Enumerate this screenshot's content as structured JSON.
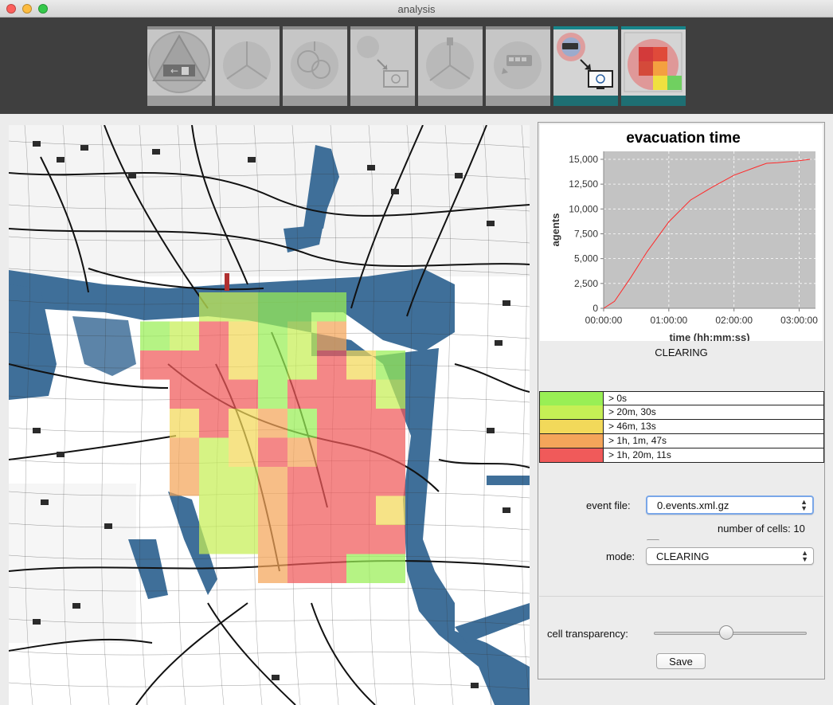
{
  "window": {
    "title": "analysis"
  },
  "toolbar": {
    "tools": [
      {
        "icon": "evacuation-area-icon",
        "state": "disabled"
      },
      {
        "icon": "population-icon",
        "state": "disabled"
      },
      {
        "icon": "population-circles-icon",
        "state": "disabled"
      },
      {
        "icon": "computation-icon",
        "state": "disabled"
      },
      {
        "icon": "road-closure-icon",
        "state": "disabled"
      },
      {
        "icon": "bus-stops-icon",
        "state": "disabled"
      },
      {
        "icon": "simulation-icon",
        "state": "active"
      },
      {
        "icon": "analysis-grid-icon",
        "state": "active"
      }
    ],
    "accent_color": "#17858a"
  },
  "chart": {
    "title": "evacuation time",
    "xlabel": "time (hh:mm:ss)",
    "ylabel": "agents"
  },
  "chart_data": {
    "type": "line",
    "title": "evacuation time",
    "xlabel": "time (hh:mm:ss)",
    "ylabel": "agents",
    "x_ticks": [
      "00:00:00",
      "01:00:00",
      "02:00:00",
      "03:00:00"
    ],
    "y_ticks": [
      "0",
      "2,500",
      "5,000",
      "7,500",
      "10,000",
      "12,500",
      "15,000"
    ],
    "xlim_seconds": [
      0,
      11700
    ],
    "ylim": [
      0,
      15800
    ],
    "grid": true,
    "series": [
      {
        "color": "#ff2a2a",
        "x_seconds": [
          0,
          600,
          1500,
          2400,
          3600,
          4800,
          6000,
          7200,
          8400,
          9000,
          9600,
          10800,
          11400
        ],
        "values": [
          0,
          700,
          3100,
          5700,
          8700,
          10900,
          12200,
          13400,
          14200,
          14600,
          14650,
          14850,
          15000
        ]
      }
    ]
  },
  "mode_caption": "CLEARING",
  "legend": [
    {
      "label": "> 0s",
      "color": "#99ef55"
    },
    {
      "label": "> 20m, 30s",
      "color": "#c6ef55"
    },
    {
      "label": "> 46m, 13s",
      "color": "#f2d95a"
    },
    {
      "label": "> 1h, 1m, 47s",
      "color": "#f4a55a"
    },
    {
      "label": "> 1h, 20m, 11s",
      "color": "#f05a5a"
    }
  ],
  "form": {
    "event_file_label": "event file:",
    "event_file_value": "0.events.xml.gz",
    "cells_label": "number of cells: 10",
    "mode_label": "mode:",
    "mode_value": "CLEARING",
    "transparency_label": "cell transparency:",
    "transparency_value": 0.5,
    "save_label": "Save"
  },
  "map": {
    "grid_columns": 10,
    "grid_rows": 10,
    "water_color": "#3f6f99",
    "cells": [
      [
        null,
        null,
        1,
        1,
        0,
        0,
        0,
        null,
        null,
        null
      ],
      [
        0,
        1,
        4,
        2,
        0,
        1,
        3,
        null,
        null,
        null
      ],
      [
        4,
        4,
        4,
        2,
        0,
        1,
        4,
        2,
        0,
        null
      ],
      [
        null,
        4,
        4,
        4,
        0,
        4,
        4,
        4,
        1,
        null
      ],
      [
        null,
        2,
        4,
        2,
        3,
        0,
        4,
        4,
        4,
        null
      ],
      [
        null,
        3,
        1,
        2,
        4,
        3,
        4,
        4,
        4,
        null
      ],
      [
        null,
        3,
        1,
        1,
        3,
        4,
        4,
        4,
        4,
        null
      ],
      [
        null,
        null,
        1,
        1,
        3,
        4,
        4,
        4,
        2,
        null
      ],
      [
        null,
        null,
        1,
        1,
        3,
        4,
        4,
        4,
        4,
        null
      ],
      [
        null,
        null,
        null,
        null,
        3,
        4,
        4,
        0,
        0,
        null
      ]
    ]
  }
}
